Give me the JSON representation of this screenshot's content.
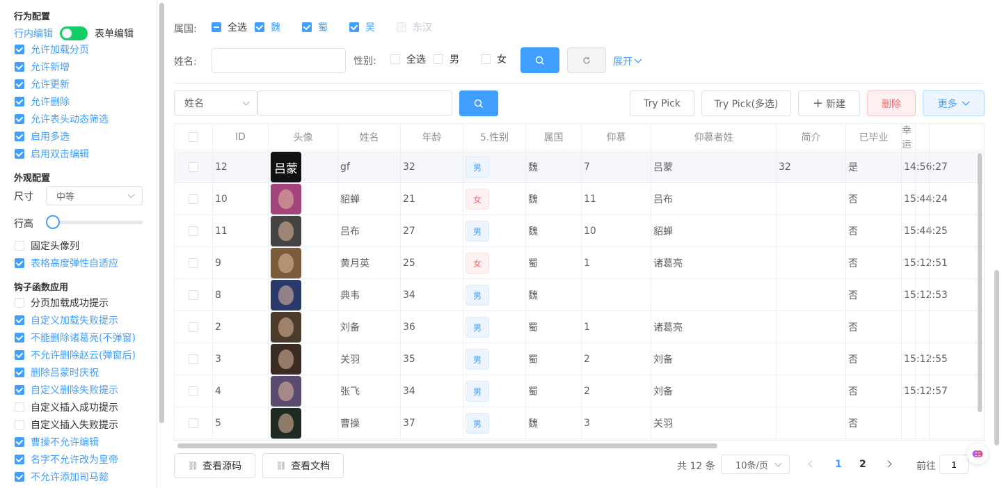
{
  "sidebar": {
    "behavior_title": "行为配置",
    "switch_left": "行内编辑",
    "switch_right": "表单编辑",
    "behavior_items": [
      {
        "label": "允许加载分页",
        "checked": true
      },
      {
        "label": "允许新增",
        "checked": true
      },
      {
        "label": "允许更新",
        "checked": true
      },
      {
        "label": "允许删除",
        "checked": true
      },
      {
        "label": "允许表头动态筛选",
        "checked": true
      },
      {
        "label": "启用多选",
        "checked": true
      },
      {
        "label": "启用双击编辑",
        "checked": true
      }
    ],
    "appearance_title": "外观配置",
    "size_label": "尺寸",
    "size_value": "中等",
    "row_height_label": "行高",
    "row_height_value": 0,
    "appearance_items": [
      {
        "label": "固定头像列",
        "checked": false
      },
      {
        "label": "表格高度弹性自适应",
        "checked": true
      }
    ],
    "hooks_title": "钩子函数应用",
    "hook_items": [
      {
        "label": "分页加载成功提示",
        "checked": false
      },
      {
        "label": "自定义加载失败提示",
        "checked": true
      },
      {
        "label": "不能删除诸葛亮(不弹窗)",
        "checked": true
      },
      {
        "label": "不允许删除赵云(弹窗后)",
        "checked": true
      },
      {
        "label": "删除吕蒙时庆祝",
        "checked": true
      },
      {
        "label": "自定义删除失败提示",
        "checked": true
      },
      {
        "label": "自定义插入成功提示",
        "checked": false
      },
      {
        "label": "自定义插入失败提示",
        "checked": false
      },
      {
        "label": "曹操不允许编辑",
        "checked": true
      },
      {
        "label": "名字不允许改为皇帝",
        "checked": true
      },
      {
        "label": "不允许添加司马懿",
        "checked": true
      }
    ]
  },
  "filters": {
    "kingdom_label": "属国:",
    "kingdom_options": [
      {
        "label": "全选",
        "state": "indeterminate"
      },
      {
        "label": "魏",
        "state": "checked"
      },
      {
        "label": "蜀",
        "state": "checked"
      },
      {
        "label": "吴",
        "state": "checked"
      },
      {
        "label": "东汉",
        "state": "disabled"
      }
    ],
    "name_label": "姓名:",
    "name_value": "",
    "gender_label": "性别:",
    "gender_options": [
      {
        "label": "全选",
        "state": "unchecked"
      },
      {
        "label": "男",
        "state": "unchecked"
      },
      {
        "label": "女",
        "state": "unchecked"
      }
    ],
    "expand_label": "展开"
  },
  "toolbar": {
    "search_field": "姓名",
    "search_value": "",
    "try_pick": "Try Pick",
    "try_pick_multi": "Try Pick(多选)",
    "new": "新建",
    "delete": "删除",
    "more": "更多"
  },
  "table": {
    "columns": [
      "ID",
      "头像",
      "姓名",
      "年龄",
      "5.性别",
      "属国",
      "仰慕",
      "仰慕者姓",
      "简介",
      "已毕业",
      "幸运"
    ],
    "rows": [
      {
        "id": "12",
        "avatar_text": "吕蒙",
        "name": "gf",
        "age": "32",
        "gender": "男",
        "kingdom": "魏",
        "admire": "7",
        "admirer": "吕蒙",
        "intro": "32",
        "graduated": "是",
        "lucky": "14:56:27"
      },
      {
        "id": "10",
        "avatar_text": "",
        "name": "貂蝉",
        "age": "21",
        "gender": "女",
        "kingdom": "魏",
        "admire": "11",
        "admirer": "吕布",
        "intro": "",
        "graduated": "否",
        "lucky": "15:44:24"
      },
      {
        "id": "11",
        "avatar_text": "",
        "name": "吕布",
        "age": "27",
        "gender": "男",
        "kingdom": "魏",
        "admire": "10",
        "admirer": "貂蝉",
        "intro": "",
        "graduated": "否",
        "lucky": "15:44:25"
      },
      {
        "id": "9",
        "avatar_text": "",
        "name": "黄月英",
        "age": "25",
        "gender": "女",
        "kingdom": "蜀",
        "admire": "1",
        "admirer": "诸葛亮",
        "intro": "",
        "graduated": "否",
        "lucky": "15:12:51"
      },
      {
        "id": "8",
        "avatar_text": "",
        "name": "典韦",
        "age": "34",
        "gender": "男",
        "kingdom": "魏",
        "admire": "",
        "admirer": "",
        "intro": "",
        "graduated": "否",
        "lucky": "15:12:53"
      },
      {
        "id": "2",
        "avatar_text": "",
        "name": "刘备",
        "age": "36",
        "gender": "男",
        "kingdom": "蜀",
        "admire": "1",
        "admirer": "诸葛亮",
        "intro": "",
        "graduated": "否",
        "lucky": ""
      },
      {
        "id": "3",
        "avatar_text": "",
        "name": "关羽",
        "age": "35",
        "gender": "男",
        "kingdom": "蜀",
        "admire": "2",
        "admirer": "刘备",
        "intro": "",
        "graduated": "否",
        "lucky": "15:12:55"
      },
      {
        "id": "4",
        "avatar_text": "",
        "name": "张飞",
        "age": "34",
        "gender": "男",
        "kingdom": "蜀",
        "admire": "2",
        "admirer": "刘备",
        "intro": "",
        "graduated": "否",
        "lucky": "15:12:57"
      },
      {
        "id": "5",
        "avatar_text": "",
        "name": "曹操",
        "age": "37",
        "gender": "男",
        "kingdom": "魏",
        "admire": "3",
        "admirer": "关羽",
        "intro": "",
        "graduated": "否",
        "lucky": ""
      }
    ]
  },
  "footer": {
    "view_source": "查看源码",
    "view_docs": "查看文档",
    "total": "共 12 条",
    "page_size": "10条/页",
    "pages": [
      "1",
      "2"
    ],
    "current_page": "1",
    "goto_label": "前往",
    "goto_value": "1"
  },
  "colors": {
    "primary": "#409eff",
    "success": "#13ce66",
    "danger": "#f56c6c"
  }
}
